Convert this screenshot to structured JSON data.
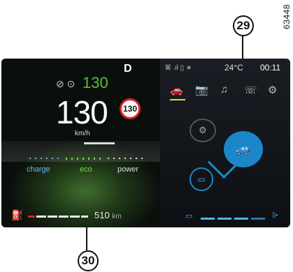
{
  "reference_code": "63448",
  "callouts": [
    "29",
    "30"
  ],
  "left": {
    "gear": "D",
    "limiter_icons": "⊘ ⊙",
    "set_speed": "130",
    "speed": "130",
    "speed_sign": "130",
    "unit": "km/h",
    "gauge_labels": {
      "charge": "charge",
      "eco": "eco",
      "power": "power"
    },
    "fuel_icon_glyph": "⛽",
    "range_value": "510",
    "range_unit": "km"
  },
  "right": {
    "status_icons": "ꕤ .ıl ▯ ∗",
    "temperature": "24°C",
    "clock": "00:11",
    "tabs": [
      {
        "name": "vehicle",
        "glyph": "🚗"
      },
      {
        "name": "camera",
        "glyph": "📷"
      },
      {
        "name": "music",
        "glyph": "♫"
      },
      {
        "name": "phone",
        "glyph": "☏"
      },
      {
        "name": "settings",
        "glyph": "⚙"
      }
    ],
    "engine_glyph": "⚙",
    "car_glyph": "🚙",
    "battery_glyph": "▭",
    "battery_meter_glyph": "▭",
    "battery_end_glyph": "⩥"
  },
  "colors": {
    "eco_green": "#6fe048",
    "set_speed_green": "#57c22f",
    "blue": "#1d88c6",
    "limit_red": "#d22"
  }
}
